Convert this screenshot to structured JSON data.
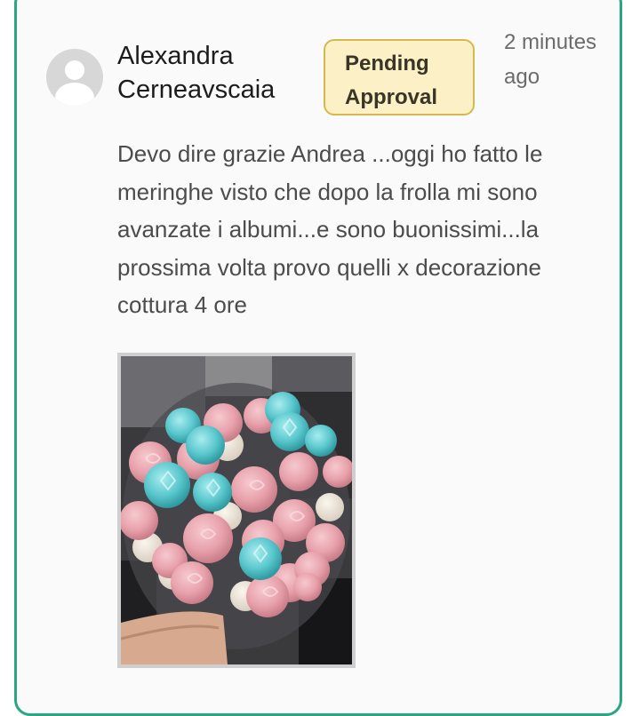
{
  "comment": {
    "author": "Alexandra Cerneavscaia",
    "status_badge": "Pending Approval",
    "timestamp": "2 minutes ago",
    "text": "Devo dire grazie Andrea ...oggi ho fatto le meringhe visto che dopo la frolla mi sono avanzate i albumi...e sono buonissimi...la prossima volta provo quelli x decorazione cottura 4 ore",
    "avatar_icon": "user-placeholder-icon",
    "attachment_icon": "meringue-photo"
  },
  "colors": {
    "card_border": "#2aa685",
    "badge_background": "#fbf0c6",
    "badge_border": "#d6b94e"
  }
}
